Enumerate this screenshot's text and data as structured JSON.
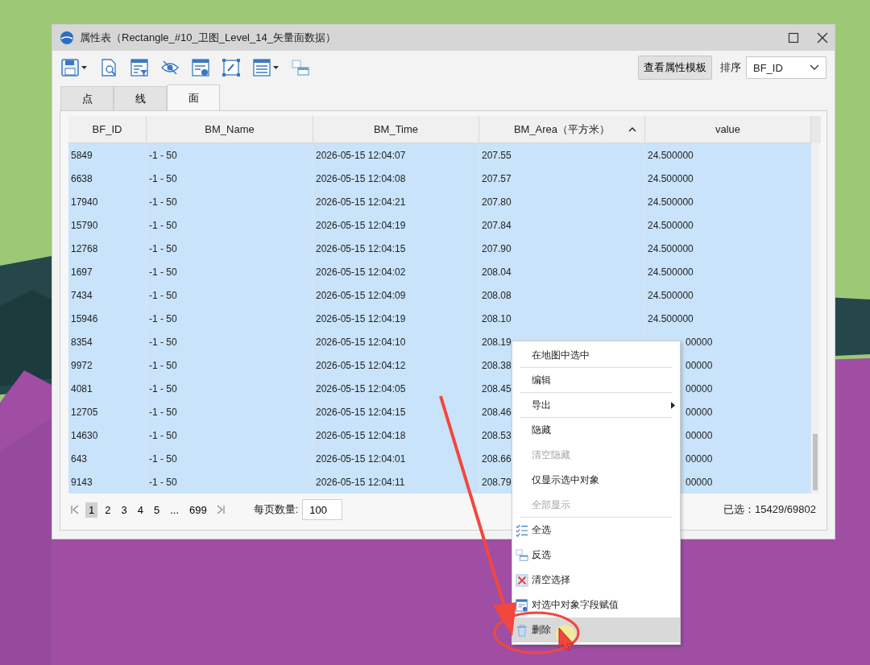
{
  "window": {
    "title": "属性表（Rectangle_#10_卫图_Level_14_矢量面数据）"
  },
  "toolbar": {
    "template_button": "查看属性模板",
    "sort_label": "排序",
    "sort_value": "BF_ID"
  },
  "tabs": [
    {
      "label": "点",
      "selected": false
    },
    {
      "label": "线",
      "selected": false
    },
    {
      "label": "面",
      "selected": true
    }
  ],
  "table": {
    "columns": [
      {
        "label": "BF_ID",
        "sorted": false
      },
      {
        "label": "BM_Name",
        "sorted": false
      },
      {
        "label": "BM_Time",
        "sorted": false
      },
      {
        "label": "BM_Area（平方米）",
        "sorted": true
      },
      {
        "label": "value",
        "sorted": false
      }
    ],
    "rows": [
      {
        "selected": true,
        "cells": [
          "5849",
          "-1 - 50",
          "2026-05-15 12:04:07",
          "207.55",
          "24.500000"
        ]
      },
      {
        "selected": true,
        "cells": [
          "6638",
          "-1 - 50",
          "2026-05-15 12:04:08",
          "207.57",
          "24.500000"
        ]
      },
      {
        "selected": true,
        "cells": [
          "17940",
          "-1 - 50",
          "2026-05-15 12:04:21",
          "207.80",
          "24.500000"
        ]
      },
      {
        "selected": true,
        "cells": [
          "15790",
          "-1 - 50",
          "2026-05-15 12:04:19",
          "207.84",
          "24.500000"
        ]
      },
      {
        "selected": true,
        "cells": [
          "12768",
          "-1 - 50",
          "2026-05-15 12:04:15",
          "207.90",
          "24.500000"
        ]
      },
      {
        "selected": true,
        "cells": [
          "1697",
          "-1 - 50",
          "2026-05-15 12:04:02",
          "208.04",
          "24.500000"
        ]
      },
      {
        "selected": true,
        "cells": [
          "7434",
          "-1 - 50",
          "2026-05-15 12:04:09",
          "208.08",
          "24.500000"
        ]
      },
      {
        "selected": true,
        "cells": [
          "15946",
          "-1 - 50",
          "2026-05-15 12:04:19",
          "208.10",
          "24.500000"
        ]
      },
      {
        "selected": true,
        "cells": [
          "8354",
          "-1 - 50",
          "2026-05-15 12:04:10",
          "208.19",
          "00000"
        ]
      },
      {
        "selected": true,
        "cells": [
          "9972",
          "-1 - 50",
          "2026-05-15 12:04:12",
          "208.38",
          "00000"
        ]
      },
      {
        "selected": true,
        "cells": [
          "4081",
          "-1 - 50",
          "2026-05-15 12:04:05",
          "208.45",
          "00000"
        ]
      },
      {
        "selected": true,
        "cells": [
          "12705",
          "-1 - 50",
          "2026-05-15 12:04:15",
          "208.46",
          "00000"
        ]
      },
      {
        "selected": true,
        "cells": [
          "14630",
          "-1 - 50",
          "2026-05-15 12:04:18",
          "208.53",
          "00000"
        ]
      },
      {
        "selected": true,
        "cells": [
          "643",
          "-1 - 50",
          "2026-05-15 12:04:01",
          "208.66",
          "00000"
        ]
      },
      {
        "selected": true,
        "cells": [
          "9143",
          "-1 - 50",
          "2026-05-15 12:04:11",
          "208.79",
          "00000"
        ]
      }
    ]
  },
  "pagination": {
    "pages": [
      {
        "label": "1",
        "selected": true
      },
      {
        "label": "2",
        "selected": false
      },
      {
        "label": "3",
        "selected": false
      },
      {
        "label": "4",
        "selected": false
      },
      {
        "label": "5",
        "selected": false
      },
      {
        "label": "...",
        "selected": false
      },
      {
        "label": "699",
        "selected": false
      }
    ],
    "page_size_label": "每页数量:",
    "page_size": "100",
    "selected_count": "已选：15429/69802"
  },
  "context_menu": [
    {
      "label": "在地图中选中",
      "kind": "plain",
      "disabled": false,
      "divider_after": true,
      "submenu": false,
      "highlighted": false
    },
    {
      "label": "编辑",
      "kind": "plain",
      "disabled": false,
      "divider_after": true,
      "submenu": false,
      "highlighted": false
    },
    {
      "label": "导出",
      "kind": "plain",
      "disabled": false,
      "divider_after": true,
      "submenu": true,
      "highlighted": false
    },
    {
      "label": "隐藏",
      "kind": "plain",
      "disabled": false,
      "divider_after": false,
      "submenu": false,
      "highlighted": false
    },
    {
      "label": "清空隐藏",
      "kind": "plain",
      "disabled": true,
      "divider_after": false,
      "submenu": false,
      "highlighted": false
    },
    {
      "label": "仅显示选中对象",
      "kind": "plain",
      "disabled": false,
      "divider_after": false,
      "submenu": false,
      "highlighted": false
    },
    {
      "label": "全部显示",
      "kind": "plain",
      "disabled": true,
      "divider_after": true,
      "submenu": false,
      "highlighted": false
    },
    {
      "label": "全选",
      "kind": "checklist",
      "disabled": false,
      "divider_after": false,
      "submenu": false,
      "highlighted": false
    },
    {
      "label": "反选",
      "kind": "swap",
      "disabled": false,
      "divider_after": false,
      "submenu": false,
      "highlighted": false
    },
    {
      "label": "清空选择",
      "kind": "clear",
      "disabled": false,
      "divider_after": false,
      "submenu": false,
      "highlighted": false
    },
    {
      "label": "对选中对象字段赋值",
      "kind": "assign",
      "disabled": false,
      "divider_after": false,
      "submenu": false,
      "highlighted": false
    },
    {
      "label": "删除",
      "kind": "trash",
      "disabled": false,
      "divider_after": false,
      "submenu": false,
      "highlighted": true
    }
  ]
}
